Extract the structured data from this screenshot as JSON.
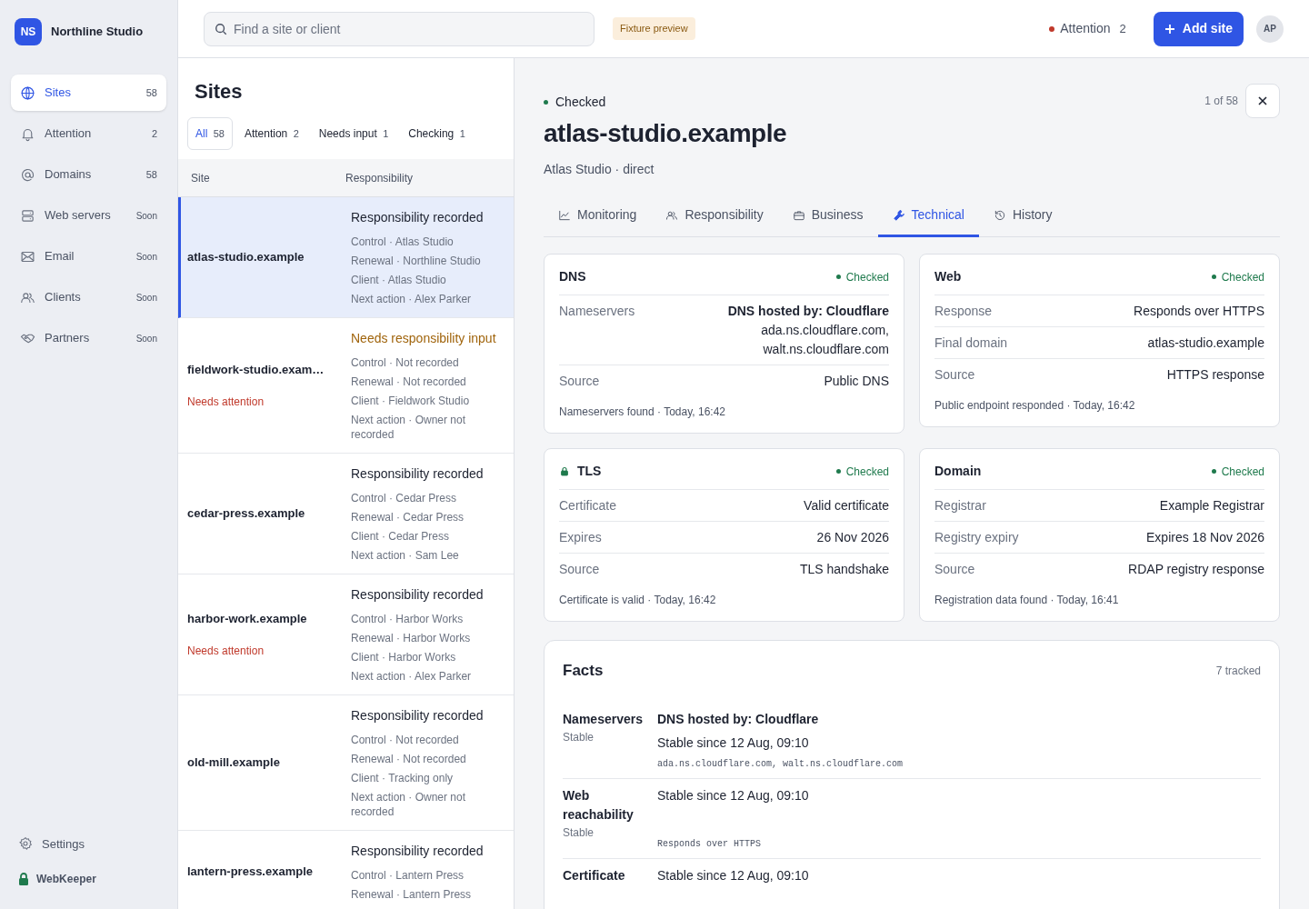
{
  "brand": {
    "initials": "NS",
    "name": "Northline Studio"
  },
  "nav": [
    {
      "label": "Sites",
      "count": "58",
      "selected": true
    },
    {
      "label": "Attention",
      "count": "2",
      "selected": false
    },
    {
      "label": "Domains",
      "count": "58",
      "selected": false
    },
    {
      "label": "Web servers",
      "count": "Soon",
      "selected": false
    },
    {
      "label": "Email",
      "count": "Soon",
      "selected": false
    },
    {
      "label": "Clients",
      "count": "Soon",
      "selected": false
    },
    {
      "label": "Partners",
      "count": "Soon",
      "selected": false
    }
  ],
  "settings": {
    "label": "Settings"
  },
  "footer": {
    "label": "WebKeeper"
  },
  "search": {
    "placeholder": "Find a site or client"
  },
  "fixture_badge": "Fixture preview",
  "attention": {
    "label": "Attention",
    "count": "2",
    "color": "#c0392b"
  },
  "add_button": "Add site",
  "avatar": "AP",
  "list": {
    "title": "Sites",
    "filters": [
      {
        "label": "All",
        "count": "58",
        "selected": true
      },
      {
        "label": "Attention",
        "count": "2",
        "selected": false
      },
      {
        "label": "Needs input",
        "count": "1",
        "selected": false
      },
      {
        "label": "Checking",
        "count": "1",
        "selected": false
      }
    ],
    "columns": [
      "Site",
      "Responsibility"
    ],
    "rows": [
      {
        "site": "atlas-studio.example",
        "selected": true,
        "needs_input": false,
        "heading": "Responsibility recorded",
        "lines": [
          "Control · Atlas Studio",
          "Renewal · Northline Studio",
          "Client · Atlas Studio",
          "Next action · Alex Parker"
        ]
      },
      {
        "site": "fieldwork-studio.exam…",
        "alert": "Needs attention",
        "selected": false,
        "needs_input": true,
        "heading": "Needs responsibility input",
        "lines": [
          "Control · Not recorded",
          "Renewal · Not recorded",
          "Client · Fieldwork Studio",
          "Next action · Owner not recorded"
        ]
      },
      {
        "site": "cedar-press.example",
        "selected": false,
        "needs_input": false,
        "heading": "Responsibility recorded",
        "lines": [
          "Control · Cedar Press",
          "Renewal · Cedar Press",
          "Client · Cedar Press",
          "Next action · Sam Lee"
        ]
      },
      {
        "site": "harbor-work.example",
        "alert": "Needs attention",
        "selected": false,
        "needs_input": false,
        "heading": "Responsibility recorded",
        "lines": [
          "Control · Harbor Works",
          "Renewal · Harbor Works",
          "Client · Harbor Works",
          "Next action · Alex Parker"
        ]
      },
      {
        "site": "old-mill.example",
        "selected": false,
        "needs_input": false,
        "heading": "Responsibility recorded",
        "lines": [
          "Control · Not recorded",
          "Renewal · Not recorded",
          "Client · Tracking only",
          "Next action · Owner not recorded"
        ]
      },
      {
        "site": "lantern-press.example",
        "selected": false,
        "needs_input": false,
        "heading": "Responsibility recorded",
        "lines": [
          "Control · Lantern Press",
          "Renewal · Lantern Press"
        ]
      }
    ]
  },
  "detail": {
    "status": {
      "label": "Checked",
      "color": "#1f7a4d"
    },
    "position": "1 of 58",
    "title": "atlas-studio.example",
    "subtitle": "Atlas Studio · direct",
    "tabs": [
      {
        "label": "Monitoring",
        "selected": false
      },
      {
        "label": "Responsibility",
        "selected": false
      },
      {
        "label": "Business",
        "selected": false
      },
      {
        "label": "Technical",
        "selected": true
      },
      {
        "label": "History",
        "selected": false
      }
    ],
    "cards": [
      {
        "title": "DNS",
        "status": "Checked",
        "rows": [
          {
            "label": "Nameservers",
            "headline": "DNS hosted by: Cloudflare",
            "values": [
              "ada.ns.cloudflare.com,",
              "walt.ns.cloudflare.com"
            ]
          },
          {
            "label": "Source",
            "values": [
              "Public DNS"
            ]
          }
        ],
        "footer": "Nameservers found · Today, 16:42"
      },
      {
        "title": "Web",
        "status": "Checked",
        "rows": [
          {
            "label": "Response",
            "values": [
              "Responds over HTTPS"
            ]
          },
          {
            "label": "Final domain",
            "values": [
              "atlas-studio.example"
            ]
          },
          {
            "label": "Source",
            "values": [
              "HTTPS response"
            ]
          }
        ],
        "footer": "Public endpoint responded · Today, 16:42"
      },
      {
        "title": "TLS",
        "status": "Checked",
        "rows": [
          {
            "label": "Certificate",
            "values": [
              "Valid certificate"
            ]
          },
          {
            "label": "Expires",
            "values": [
              "26 Nov 2026"
            ]
          },
          {
            "label": "Source",
            "values": [
              "TLS handshake"
            ]
          }
        ],
        "footer": "Certificate is valid · Today, 16:42"
      },
      {
        "title": "Domain",
        "status": "Checked",
        "rows": [
          {
            "label": "Registrar",
            "values": [
              "Example Registrar"
            ]
          },
          {
            "label": "Registry expiry",
            "values": [
              "Expires 18 Nov 2026"
            ]
          },
          {
            "label": "Source",
            "values": [
              "RDAP registry response"
            ]
          }
        ],
        "footer": "Registration data found · Today, 16:41"
      }
    ],
    "facts": {
      "title": "Facts",
      "count": "7 tracked",
      "rows": [
        {
          "label": "Nameservers",
          "state": "Stable",
          "headline": "DNS hosted by: Cloudflare",
          "since": "Stable since 12 Aug, 09:10",
          "detail": "ada.ns.cloudflare.com, walt.ns.cloudflare.com"
        },
        {
          "label": "Web reachability",
          "state": "Stable",
          "since": "Stable since 12 Aug, 09:10",
          "detail": "Responds over HTTPS"
        },
        {
          "label": "Certificate",
          "since": "Stable since 12 Aug, 09:10"
        }
      ]
    }
  }
}
